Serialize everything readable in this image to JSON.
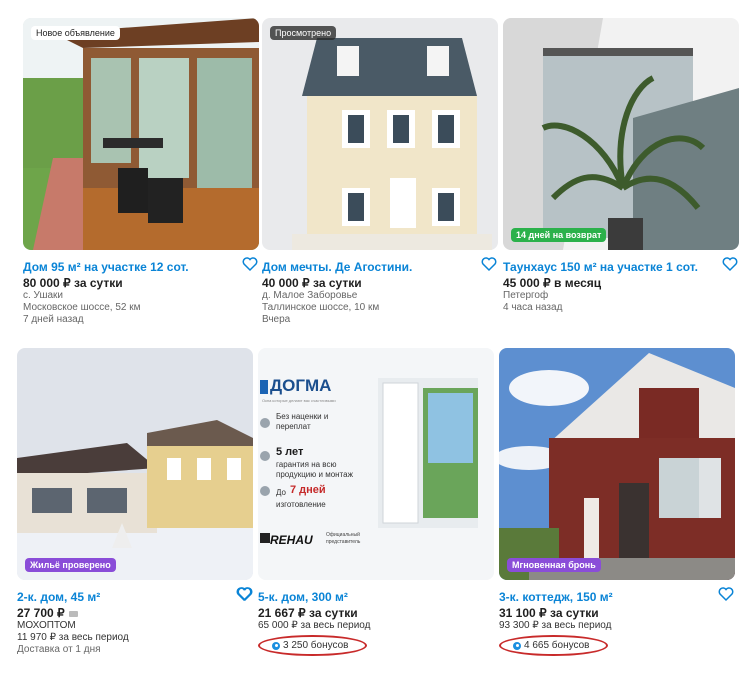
{
  "colors": {
    "link": "#0a84d6",
    "badge_return": "#2bb14b",
    "badge_verified": "#8a4dd8",
    "badge_instant": "#8a4dd8",
    "bonus_outline": "#c82a2a"
  },
  "cards": [
    {
      "badge": "Новое объявление",
      "title": "Дом 95 м² на участке 12 сот.",
      "price": "80 000 ₽ за сутки",
      "lines": [
        "с. Ушаки",
        "Московское шоссе, 52 км",
        "7 дней назад"
      ]
    },
    {
      "badge": "Просмотрено",
      "title": "Дом мечты. Де Агостини.",
      "price": "40 000 ₽ за сутки",
      "lines": [
        "д. Малое Заборовье",
        "Таллинское шоссе, 10 км",
        "Вчера"
      ]
    },
    {
      "badge": "14 дней на возврат",
      "title": "Таунхаус 150 м² на участке 1 сот.",
      "price": "45 000 ₽ в месяц",
      "lines": [
        "Петергоф",
        "4 часа назад"
      ]
    },
    {
      "badge": "Жильё проверено",
      "title": "2-к. дом, 45 м²",
      "price": "27 700 ₽",
      "lines": [
        "МОХОПТОМ",
        "11 970 ₽ за весь период",
        "Доставка от 1 дня"
      ]
    },
    {
      "title": "5-к. дом, 300 м²",
      "price": "21 667 ₽ за сутки",
      "lines": [
        "65 000 ₽ за весь период"
      ],
      "bonus": "3 250 бонусов",
      "ad": {
        "brand": "ДОГМА",
        "tagline": "Окна которые делают вас счастливыми",
        "f1": "Без наценки и переплат",
        "f2_big": "5 лет",
        "f2": "гарантия на всю продукцию и монтаж",
        "f3_pre": "До",
        "f3_big": "7 дней",
        "f3": "изготовление",
        "partner": "REHAU",
        "partner_note": "Официальный представитель"
      }
    },
    {
      "badge": "Мгновенная бронь",
      "title": "3-к. коттедж, 150 м²",
      "price": "31 100 ₽ за сутки",
      "lines": [
        "93 300 ₽ за весь период"
      ],
      "bonus": "4 665 бонусов"
    }
  ]
}
